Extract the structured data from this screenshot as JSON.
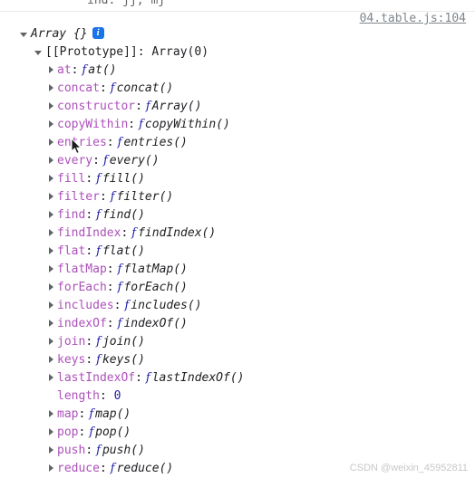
{
  "console": {
    "previous_line_text": "ind. jj, mj",
    "source_link": "04.table.js:104",
    "watermark": "CSDN @weixin_45952811",
    "root": {
      "label": "Array {}",
      "info_icon": "i",
      "expanded": true
    },
    "prototype": {
      "key": "[[Prototype]]",
      "separator": ":",
      "value": "Array(0)",
      "expanded": true
    },
    "properties": [
      {
        "key": "at",
        "sep": ":",
        "fn_mark": "f",
        "value": "at()",
        "expandable": true
      },
      {
        "key": "concat",
        "sep": ":",
        "fn_mark": "f",
        "value": "concat()",
        "expandable": true
      },
      {
        "key": "constructor",
        "sep": ":",
        "fn_mark": "f",
        "value": "Array()",
        "expandable": true
      },
      {
        "key": "copyWithin",
        "sep": ":",
        "fn_mark": "f",
        "value": "copyWithin()",
        "expandable": true
      },
      {
        "key": "entries",
        "sep": ":",
        "fn_mark": "f",
        "value": "entries()",
        "expandable": true
      },
      {
        "key": "every",
        "sep": ":",
        "fn_mark": "f",
        "value": "every()",
        "expandable": true
      },
      {
        "key": "fill",
        "sep": ":",
        "fn_mark": "f",
        "value": "fill()",
        "expandable": true
      },
      {
        "key": "filter",
        "sep": ":",
        "fn_mark": "f",
        "value": "filter()",
        "expandable": true
      },
      {
        "key": "find",
        "sep": ":",
        "fn_mark": "f",
        "value": "find()",
        "expandable": true
      },
      {
        "key": "findIndex",
        "sep": ":",
        "fn_mark": "f",
        "value": "findIndex()",
        "expandable": true
      },
      {
        "key": "flat",
        "sep": ":",
        "fn_mark": "f",
        "value": "flat()",
        "expandable": true
      },
      {
        "key": "flatMap",
        "sep": ":",
        "fn_mark": "f",
        "value": "flatMap()",
        "expandable": true
      },
      {
        "key": "forEach",
        "sep": ":",
        "fn_mark": "f",
        "value": "forEach()",
        "expandable": true
      },
      {
        "key": "includes",
        "sep": ":",
        "fn_mark": "f",
        "value": "includes()",
        "expandable": true
      },
      {
        "key": "indexOf",
        "sep": ":",
        "fn_mark": "f",
        "value": "indexOf()",
        "expandable": true
      },
      {
        "key": "join",
        "sep": ":",
        "fn_mark": "f",
        "value": "join()",
        "expandable": true
      },
      {
        "key": "keys",
        "sep": ":",
        "fn_mark": "f",
        "value": "keys()",
        "expandable": true
      },
      {
        "key": "lastIndexOf",
        "sep": ":",
        "fn_mark": "f",
        "value": "lastIndexOf()",
        "expandable": true
      },
      {
        "key": "length",
        "sep": ":",
        "fn_mark": "",
        "value": "0",
        "expandable": false,
        "is_number": true
      },
      {
        "key": "map",
        "sep": ":",
        "fn_mark": "f",
        "value": "map()",
        "expandable": true
      },
      {
        "key": "pop",
        "sep": ":",
        "fn_mark": "f",
        "value": "pop()",
        "expandable": true
      },
      {
        "key": "push",
        "sep": ":",
        "fn_mark": "f",
        "value": "push()",
        "expandable": true
      },
      {
        "key": "reduce",
        "sep": ":",
        "fn_mark": "f",
        "value": "reduce()",
        "expandable": true
      }
    ]
  },
  "colors": {
    "property_name": "#ac50ba",
    "function_mark": "#1a1aa6",
    "number_value": "#1a1aa6",
    "source_link": "#80868b",
    "info_icon_bg": "#1a73e8",
    "text": "#202124"
  }
}
